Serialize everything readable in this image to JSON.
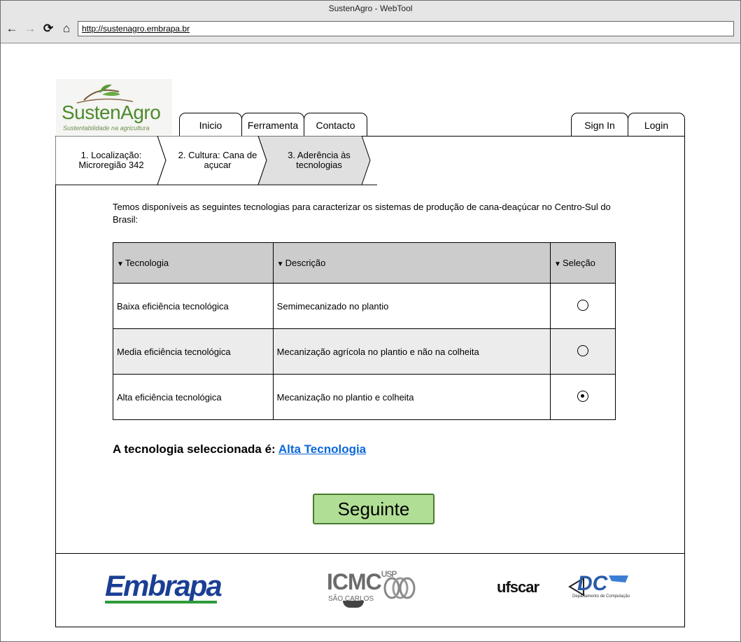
{
  "window": {
    "title": "SustenAgro - WebTool",
    "url": "http://sustenagro.embrapa.br"
  },
  "nav_icons": {
    "back": "←",
    "forward": "→",
    "reload": "⟳",
    "home": "⌂"
  },
  "logo": {
    "name": "SustenAgro",
    "tagline": "Sustentabilidade na agricultura"
  },
  "tabs": {
    "inicio": "Inicio",
    "ferramenta": "Ferramenta",
    "contacto": "Contacto",
    "sign_in": "Sign In",
    "login": "Login"
  },
  "steps": [
    {
      "line1": "1. Localização:",
      "line2": "Microregião 342",
      "active": false
    },
    {
      "line1": "2. Cultura: Cana de",
      "line2": "açucar",
      "active": false
    },
    {
      "line1": "3. Aderência às",
      "line2": "tecnologias",
      "active": true
    }
  ],
  "intro": "Temos disponíveis as seguintes tecnologias para caracterizar os sistemas de produção de cana-deaçúcar no Centro-Sul do Brasil:",
  "table": {
    "headers": {
      "tecnologia": "Tecnologia",
      "descricao": "Descrição",
      "selecao": "Seleção"
    },
    "rows": [
      {
        "tecnologia": "Baixa eficiência tecnológica",
        "descricao": "Semimecanizado no plantio",
        "selected": false
      },
      {
        "tecnologia": "Media eficiência tecnológica",
        "descricao": "Mecanização agrícola no plantio e não na colheita",
        "selected": false
      },
      {
        "tecnologia": "Alta eficiência tecnológica",
        "descricao": "Mecanização no plantio e colheita",
        "selected": true
      }
    ]
  },
  "selection": {
    "label": "A tecnologia seleccionada é:",
    "value": "Alta Tecnologia"
  },
  "next_button": "Seguinte",
  "footer": {
    "embrapa": "Embrapa",
    "icmc": "ICMC",
    "icmc_usp": "USP",
    "icmc_sub": "SÃO CARLOS",
    "ufscar": "ufscar",
    "dc": "DC",
    "dc_sub": "Departamento de Computação"
  },
  "colors": {
    "accent_green": "#b1de95",
    "link_blue": "#0b67d8",
    "header_gray": "#cccccc"
  }
}
